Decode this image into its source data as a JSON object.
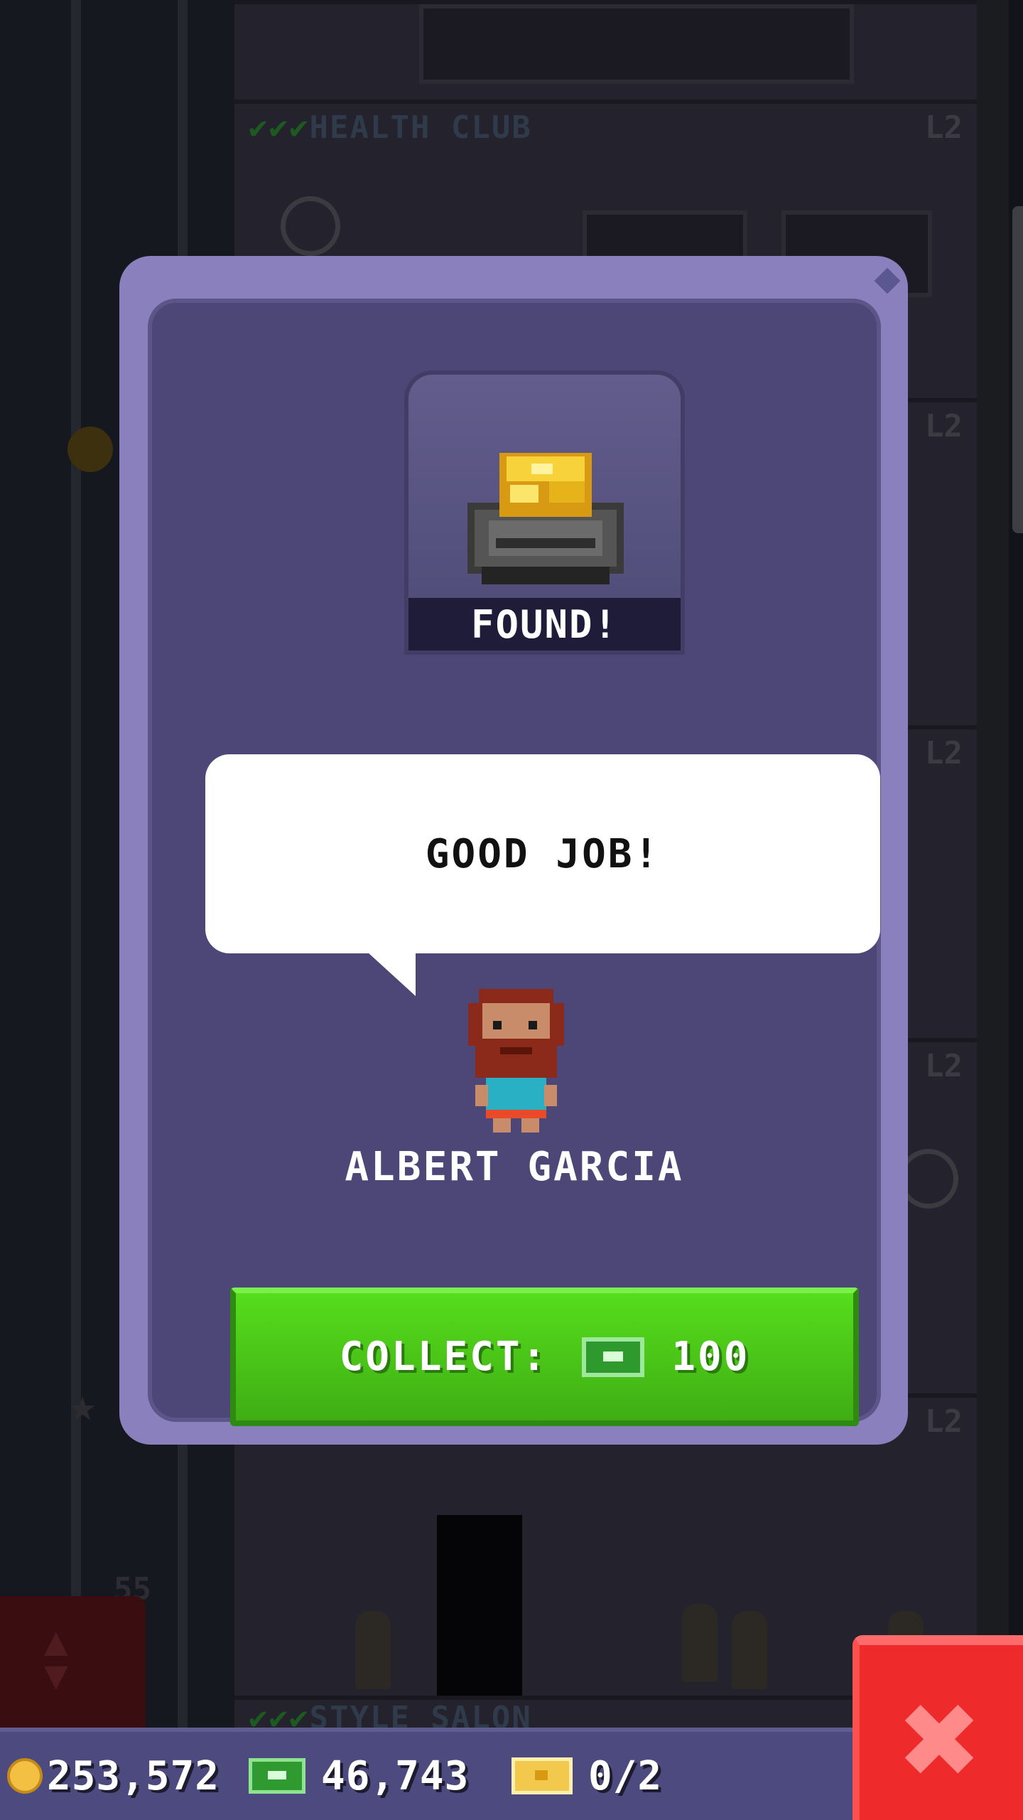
{
  "background": {
    "floors": [
      {
        "name": "HEALTH CLUB",
        "level": "L2",
        "checks": "✔✔✔"
      },
      {
        "name": "",
        "level": "L2",
        "checks": ""
      },
      {
        "name": "",
        "level": "L2",
        "checks": ""
      },
      {
        "name": "",
        "level": "L2",
        "checks": ""
      },
      {
        "name": "",
        "level": "L2",
        "checks": ""
      },
      {
        "name": "STYLE SALON",
        "level": "",
        "checks": "✔✔✔"
      }
    ],
    "floor_number": "55"
  },
  "modal": {
    "status_label": "FOUND!",
    "item_icon": "gold-ingot-icon",
    "speech": "GOOD JOB!",
    "character_name": "ALBERT GARCIA",
    "collect_label": "COLLECT:",
    "collect_currency_icon": "bux-icon",
    "collect_amount": "100"
  },
  "status_bar": {
    "coins": "253,572",
    "bux": "46,743",
    "tickets": "0/2"
  },
  "colors": {
    "modal_frame": "#8a80bd",
    "modal_body": "#4c4776",
    "collect_green": "#4fc619",
    "close_red": "#ee2a2a",
    "status_bar": "#4c4a7e"
  }
}
